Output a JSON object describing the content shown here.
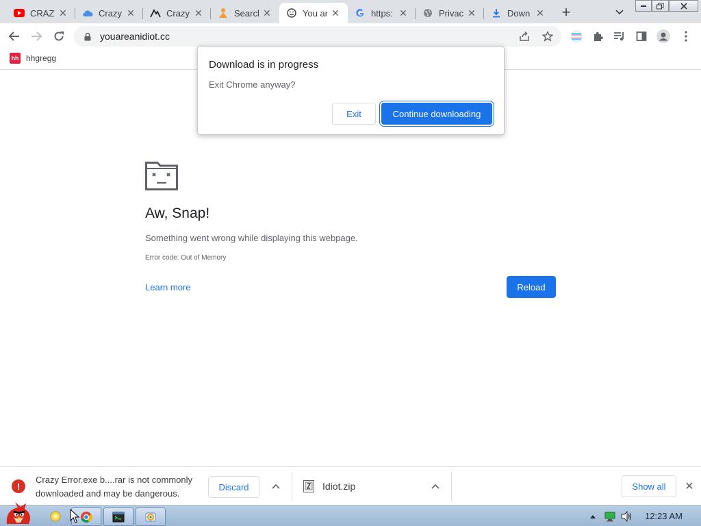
{
  "tabs": [
    {
      "title": "CRAZY",
      "icon": "youtube-icon"
    },
    {
      "title": "Crazy",
      "icon": "cloud-icon"
    },
    {
      "title": "Crazy",
      "icon": "mountain-icon"
    },
    {
      "title": "Search",
      "icon": "person-icon"
    },
    {
      "title": "You are",
      "icon": "smiley-icon",
      "active": true
    },
    {
      "title": "https:",
      "icon": "google-g-icon"
    },
    {
      "title": "Privacy",
      "icon": "globe-icon"
    },
    {
      "title": "Down",
      "icon": "download-icon"
    }
  ],
  "address_bar": {
    "url": "youareanidiot.cc"
  },
  "bookmarks": [
    {
      "label": "hhgregg",
      "favicon_text": "hh"
    }
  ],
  "dialog": {
    "title": "Download is in progress",
    "message": "Exit Chrome anyway?",
    "exit_label": "Exit",
    "continue_label": "Continue downloading"
  },
  "sad_tab": {
    "title": "Aw, Snap!",
    "message": "Something went wrong while displaying this webpage.",
    "error_code": "Error code: Out of Memory",
    "learn_more": "Learn more",
    "reload_label": "Reload"
  },
  "download_shelf": {
    "warning_text": "Crazy Error.exe b....rar is not commonly downloaded and may be dangerous.",
    "discard_label": "Discard",
    "file_name": "Idiot.zip",
    "show_all_label": "Show all"
  },
  "taskbar": {
    "clock": "12:23 AM"
  },
  "colors": {
    "accent": "#1a73e8",
    "warning": "#d93025",
    "tabstrip": "#dee1e6"
  }
}
